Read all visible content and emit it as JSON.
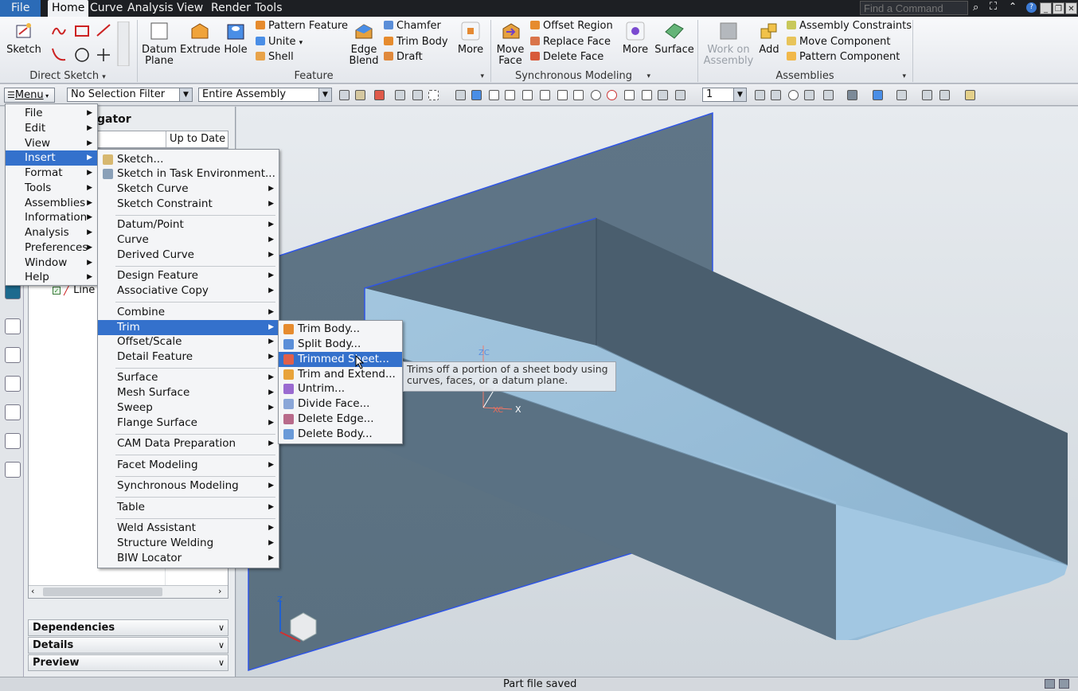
{
  "menubar": {
    "file": "File",
    "tabs": [
      "Home",
      "Curve",
      "Analysis",
      "View",
      "Render",
      "Tools"
    ],
    "find_placeholder": "Find a Command"
  },
  "ribbon": {
    "sketch": "Sketch",
    "direct_sketch_group": "Direct Sketch",
    "datum_plane": "Datum Plane",
    "extrude": "Extrude",
    "hole": "Hole",
    "pattern_feature": "Pattern Feature",
    "unite": "Unite",
    "shell": "Shell",
    "edge_blend": "Edge Blend",
    "chamfer": "Chamfer",
    "trim_body": "Trim Body",
    "draft": "Draft",
    "more": "More",
    "feature_group": "Feature",
    "move_face": "Move Face",
    "offset_region": "Offset Region",
    "replace_face": "Replace Face",
    "delete_face": "Delete Face",
    "more2": "More",
    "sync_group": "Synchronous Modeling",
    "surface": "Surface",
    "work_on_assembly": "Work on Assembly",
    "add": "Add",
    "assembly_constraints": "Assembly Constraints",
    "move_component": "Move Component",
    "pattern_component": "Pattern Component",
    "assemblies_group": "Assemblies"
  },
  "toolbar2": {
    "menu": "Menu",
    "selection_filter": "No Selection Filter",
    "scope": "Entire Assembly",
    "layer": "1"
  },
  "nav": {
    "title_fragment": "gator",
    "up_to_date": "Up to Date",
    "row_line": "Line",
    "dependencies": "Dependencies",
    "details": "Details",
    "preview": "Preview"
  },
  "main_menu": [
    "File",
    "Edit",
    "View",
    "Insert",
    "Format",
    "Tools",
    "Assemblies",
    "Information",
    "Analysis",
    "Preferences",
    "Window",
    "Help"
  ],
  "insert_menu": [
    "Sketch...",
    "Sketch in Task Environment...",
    "Sketch Curve",
    "Sketch Constraint",
    "Datum/Point",
    "Curve",
    "Derived Curve",
    "Design Feature",
    "Associative Copy",
    "Combine",
    "Trim",
    "Offset/Scale",
    "Detail Feature",
    "Surface",
    "Mesh Surface",
    "Sweep",
    "Flange Surface",
    "CAM Data Preparation",
    "Facet Modeling",
    "Synchronous Modeling",
    "Table",
    "Weld Assistant",
    "Structure Welding",
    "BIW Locator"
  ],
  "trim_menu": [
    "Trim Body...",
    "Split Body...",
    "Trimmed Sheet...",
    "Trim and Extend...",
    "Untrim...",
    "Divide Face...",
    "Delete Edge...",
    "Delete Body..."
  ],
  "tooltip": {
    "line1": "Trims off a portion of a sheet body using",
    "line2": "curves, faces, or a datum plane."
  },
  "triad": {
    "zc": "ZC",
    "x": "X",
    "xc": "XC",
    "z": "Z"
  },
  "status": "Part file saved",
  "colors": {
    "highlight": "#3471cc",
    "model_face": "#5d7385",
    "model_light": "#9fc3dd",
    "edge": "#2f55e6"
  }
}
